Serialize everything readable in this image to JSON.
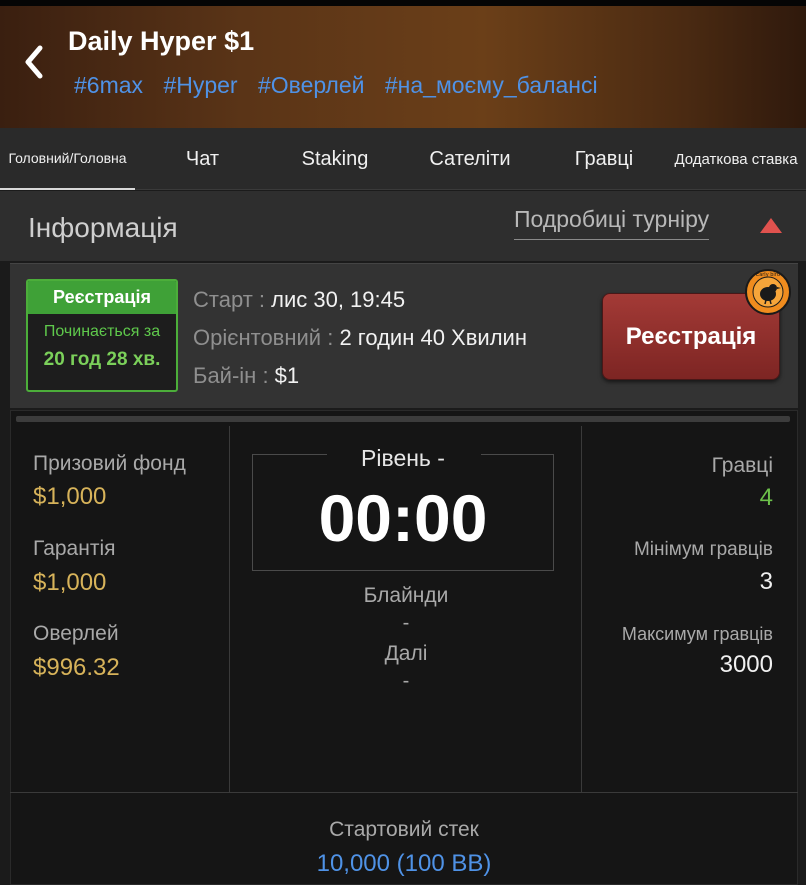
{
  "header": {
    "title": "Daily Hyper $1",
    "tags": [
      "#6max",
      "#Hyper",
      "#Оверлей",
      "#на_моєму_балансі"
    ]
  },
  "tabs": [
    {
      "label": "Головний/Головна",
      "active": true
    },
    {
      "label": "Чат"
    },
    {
      "label": "Staking"
    },
    {
      "label": "Сателіти"
    },
    {
      "label": "Гравці"
    },
    {
      "label": "Додаткова ставка"
    }
  ],
  "info": {
    "title": "Інформація",
    "details_link": "Подробиці турніру"
  },
  "registration": {
    "badge_title": "Реєстрація",
    "starts_in_label": "Починається за",
    "starts_in_value": "20 год 28 хв.",
    "start_label": "Старт",
    "start_value": "лис 30, 19:45",
    "duration_label": "Орієнтовний",
    "duration_value": "2 годин 40 Хвилин",
    "buyin_label": "Бай-ін",
    "buyin_value": "$1",
    "register_button": "Реєстрація",
    "early_bird_text": "Early bird"
  },
  "stats": {
    "prize_pool_label": "Призовий фонд",
    "prize_pool_value": "$1,000",
    "guarantee_label": "Гарантія",
    "guarantee_value": "$1,000",
    "overlay_label": "Оверлей",
    "overlay_value": "$996.32",
    "level_label": "Рівень -",
    "clock": "00:00",
    "blinds_label": "Блайнди",
    "blinds_value": "-",
    "next_label": "Далі",
    "next_value": "-",
    "players_label": "Гравці",
    "players_value": "4",
    "min_players_label": "Мінімум гравців",
    "min_players_value": "3",
    "max_players_label": "Максимум гравців",
    "max_players_value": "3000",
    "starting_stack_label": "Стартовий стек",
    "starting_stack_value": "10,000 (100 BB)"
  },
  "colors": {
    "accent_blue": "#4f92e6",
    "gold": "#d7b35a",
    "green": "#3fa137",
    "register_red": "#8e2f2c",
    "players_green": "#6cc04a"
  }
}
